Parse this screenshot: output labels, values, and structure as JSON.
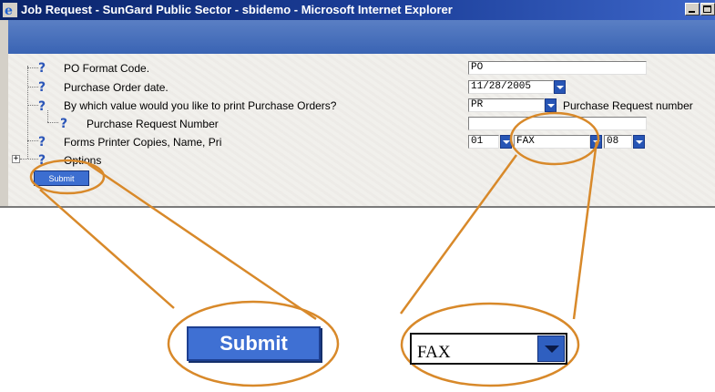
{
  "window": {
    "title": "Job Request - SunGard Public Sector - sbidemo - Microsoft Internet Explorer"
  },
  "form": {
    "rows": [
      {
        "label": "PO Format Code.",
        "value": "PO"
      },
      {
        "label": "Purchase Order date.",
        "value": "11/28/2005"
      },
      {
        "label": "By which value would you like to print Purchase Orders?",
        "value": "PR",
        "after_text": "Purchase Request number"
      },
      {
        "label": "Purchase Request Number",
        "value": ""
      },
      {
        "label": "Forms Printer Copies, Name, Pri",
        "copies": "01",
        "printer": "FAX",
        "priority": "08"
      },
      {
        "label": "Options"
      }
    ],
    "submit_label": "Submit"
  },
  "zoom": {
    "submit_label": "Submit",
    "select_value": "FAX"
  },
  "colors": {
    "highlight_ring": "#d8892a",
    "button_blue": "#3c6ed0",
    "title_blue": "#0a246a"
  },
  "icons": [
    "ie-logo-icon",
    "help-question-icon",
    "dropdown-arrow-icon",
    "expand-plus-icon",
    "minimize-icon",
    "maximize-icon"
  ]
}
